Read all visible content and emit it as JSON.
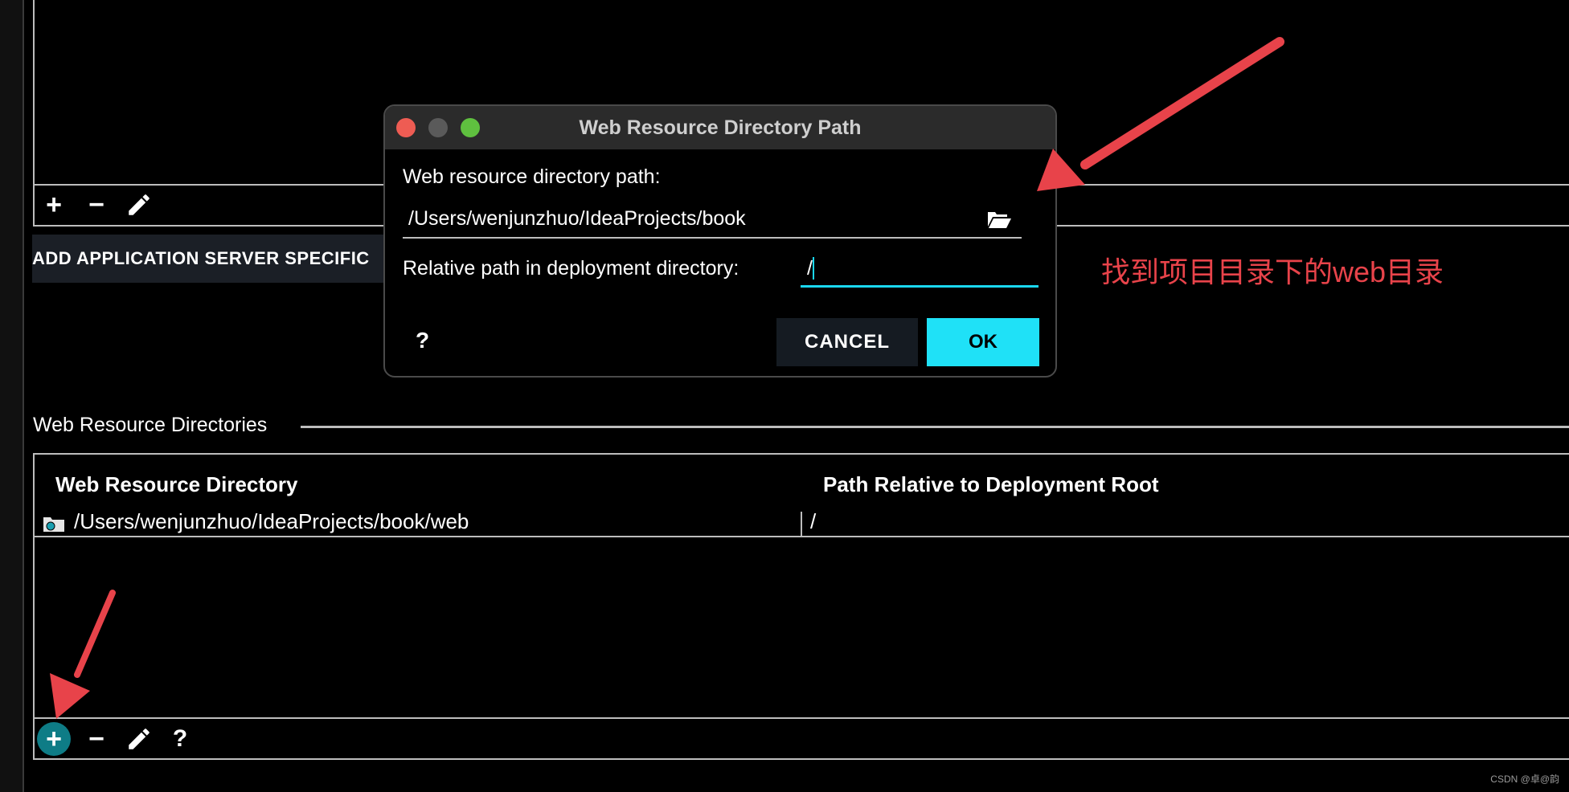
{
  "top_panel": {
    "add_label": "+",
    "remove_label": "−",
    "add_server_button": "ADD APPLICATION SERVER SPECIFIC"
  },
  "web_resources": {
    "section_title": "Web Resource Directories",
    "columns": [
      "Web Resource Directory",
      "Path Relative to Deployment Root"
    ],
    "rows": [
      {
        "directory": "/Users/wenjunzhuo/IdeaProjects/book/web",
        "relative_path": "/"
      }
    ],
    "toolbar": {
      "add_label": "+",
      "remove_label": "−",
      "help_label": "?"
    }
  },
  "dialog": {
    "title": "Web Resource Directory Path",
    "path_label": "Web resource directory path:",
    "path_value": "/Users/wenjunzhuo/IdeaProjects/book",
    "relative_label": "Relative path in deployment directory:",
    "relative_value": "/",
    "help_label": "?",
    "cancel_label": "CANCEL",
    "ok_label": "OK"
  },
  "annotation": {
    "text": "找到项目目录下的web目录",
    "color": "#e8434a"
  },
  "colors": {
    "accent": "#1fe1f7",
    "annotation": "#e8434a",
    "active_add": "#0e7c86"
  },
  "watermark": "CSDN @卓@韵"
}
